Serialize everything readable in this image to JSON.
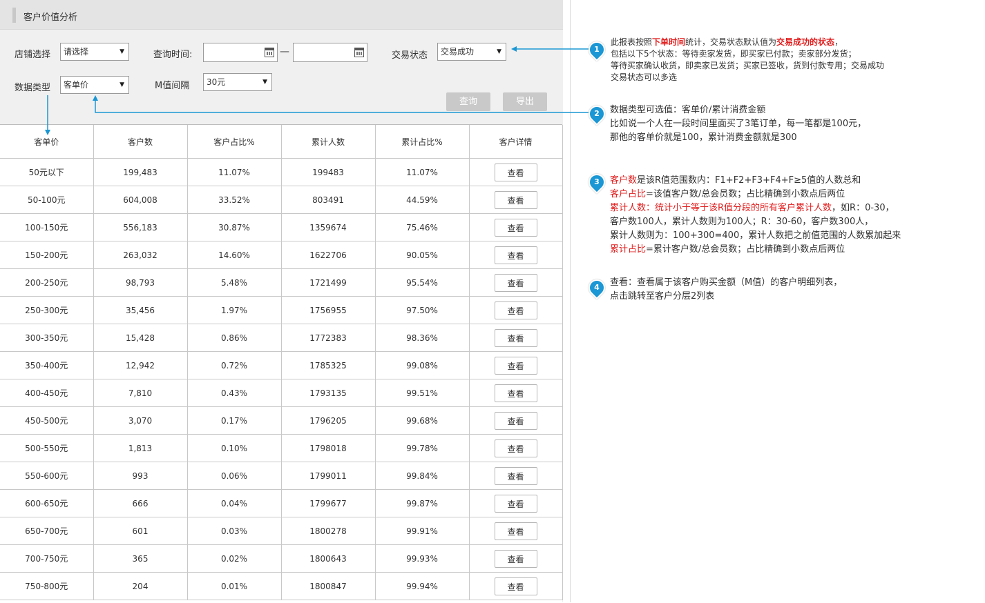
{
  "header": {
    "title": "客户价值分析"
  },
  "filters": {
    "shop_label": "店铺选择",
    "shop_value": "请选择",
    "time_label": "查询时间:",
    "time_separator": "—",
    "status_label": "交易状态",
    "status_value": "交易成功",
    "type_label": "数据类型",
    "type_value": "客单价",
    "interval_label": "M值间隔",
    "interval_value": "30元",
    "query_button": "查询",
    "export_button": "导出"
  },
  "table": {
    "columns": [
      "客单价",
      "客户数",
      "客户占比%",
      "累计人数",
      "累计占比%",
      "客户详情"
    ],
    "view_label": "查看",
    "rows": [
      [
        "50元以下",
        "199,483",
        "11.07%",
        "199483",
        "11.07%"
      ],
      [
        "50-100元",
        "604,008",
        "33.52%",
        "803491",
        "44.59%"
      ],
      [
        "100-150元",
        "556,183",
        "30.87%",
        "1359674",
        "75.46%"
      ],
      [
        "150-200元",
        "263,032",
        "14.60%",
        "1622706",
        "90.05%"
      ],
      [
        "200-250元",
        "98,793",
        "5.48%",
        "1721499",
        "95.54%"
      ],
      [
        "250-300元",
        "35,456",
        "1.97%",
        "1756955",
        "97.50%"
      ],
      [
        "300-350元",
        "15,428",
        "0.86%",
        "1772383",
        "98.36%"
      ],
      [
        "350-400元",
        "12,942",
        "0.72%",
        "1785325",
        "99.08%"
      ],
      [
        "400-450元",
        "7,810",
        "0.43%",
        "1793135",
        "99.51%"
      ],
      [
        "450-500元",
        "3,070",
        "0.17%",
        "1796205",
        "99.68%"
      ],
      [
        "500-550元",
        "1,813",
        "0.10%",
        "1798018",
        "99.78%"
      ],
      [
        "550-600元",
        "993",
        "0.06%",
        "1799011",
        "99.84%"
      ],
      [
        "600-650元",
        "666",
        "0.04%",
        "1799677",
        "99.87%"
      ],
      [
        "650-700元",
        "601",
        "0.03%",
        "1800278",
        "99.91%"
      ],
      [
        "700-750元",
        "365",
        "0.02%",
        "1800643",
        "99.93%"
      ],
      [
        "750-800元",
        "204",
        "0.01%",
        "1800847",
        "99.94%"
      ]
    ]
  },
  "annotations": {
    "a1": {
      "num": "1",
      "l1_pre": "此报表按照",
      "l1_red1": "下单时间",
      "l1_mid": "统计，交易状态默认值为",
      "l1_red2": "交易成功的状态",
      "l1_end": "，",
      "l2": "包括以下5个状态：等待卖家发货，即买家已付款；卖家部分发货；",
      "l3": "等待买家确认收货，即卖家已发货；买家已签收，货到付款专用；交易成功",
      "l4": "交易状态可以多选"
    },
    "a2": {
      "num": "2",
      "l1": "数据类型可选值：客单价/累计消费金额",
      "l2": "比如说一个人在一段时间里面买了3笔订单，每一笔都是100元，",
      "l3": "那他的客单价就是100，累计消费金额就是300"
    },
    "a3": {
      "num": "3",
      "l1_red": "客户数",
      "l1_rest": "是该R值范围数内：F1+F2+F3+F4+F≥5值的人数总和",
      "l2_red": "客户占比",
      "l2_rest": "=该值客户数/总会员数；占比精确到小数点后两位",
      "l3_red": "累计人数：统计小于等于该R值分段的所有客户累计人数",
      "l3_rest": "，如R：0-30，",
      "l4": "客户数100人，累计人数则为100人；R：30-60，客户数300人，",
      "l5": "累计人数则为：100+300=400，累计人数把之前值范围的人数累加起来",
      "l6_red": "累计占比",
      "l6_rest": "=累计客户数/总会员数；占比精确到小数点后两位"
    },
    "a4": {
      "num": "4",
      "l1": "查看：查看属于该客户购买金额（M值）的客户明细列表，",
      "l2": "点击跳转至客户分层2列表"
    }
  },
  "colors": {
    "accent": "#1a97d4",
    "highlight": "#e12020",
    "button_disabled": "#c9c9c9"
  }
}
